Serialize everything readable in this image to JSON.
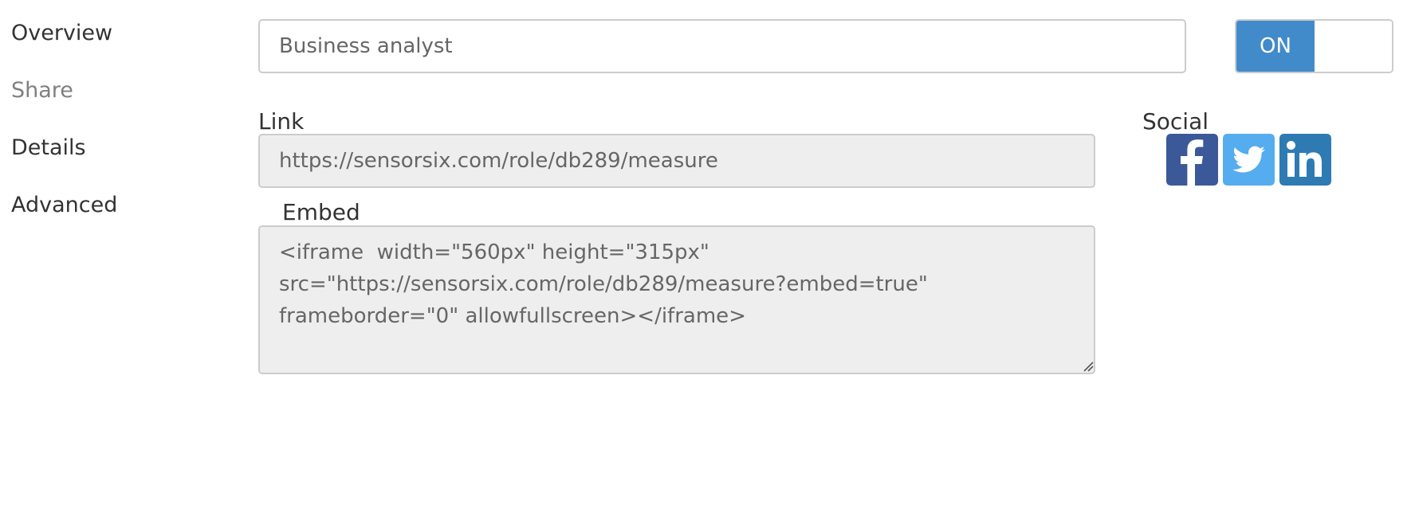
{
  "sidebar": {
    "items": [
      {
        "label": "Overview"
      },
      {
        "label": "Share"
      },
      {
        "label": "Details"
      },
      {
        "label": "Advanced"
      }
    ]
  },
  "role": {
    "name_value": "Business analyst",
    "toggle_label": "ON"
  },
  "share": {
    "link_label": "Link",
    "link_value": "https://sensorsix.com/role/db289/measure",
    "embed_label": "Embed",
    "embed_value": "<iframe  width=\"560px\" height=\"315px\" src=\"https://sensorsix.com/role/db289/measure?embed=true\" frameborder=\"0\" allowfullscreen></iframe>",
    "social_label": "Social",
    "social_icons": [
      "facebook-icon",
      "twitter-icon",
      "linkedin-icon"
    ]
  },
  "colors": {
    "accent": "#428bca",
    "facebook": "#3b5998",
    "twitter": "#55acee",
    "linkedin": "#2e7bb4",
    "readonly_bg": "#eeeeee"
  }
}
